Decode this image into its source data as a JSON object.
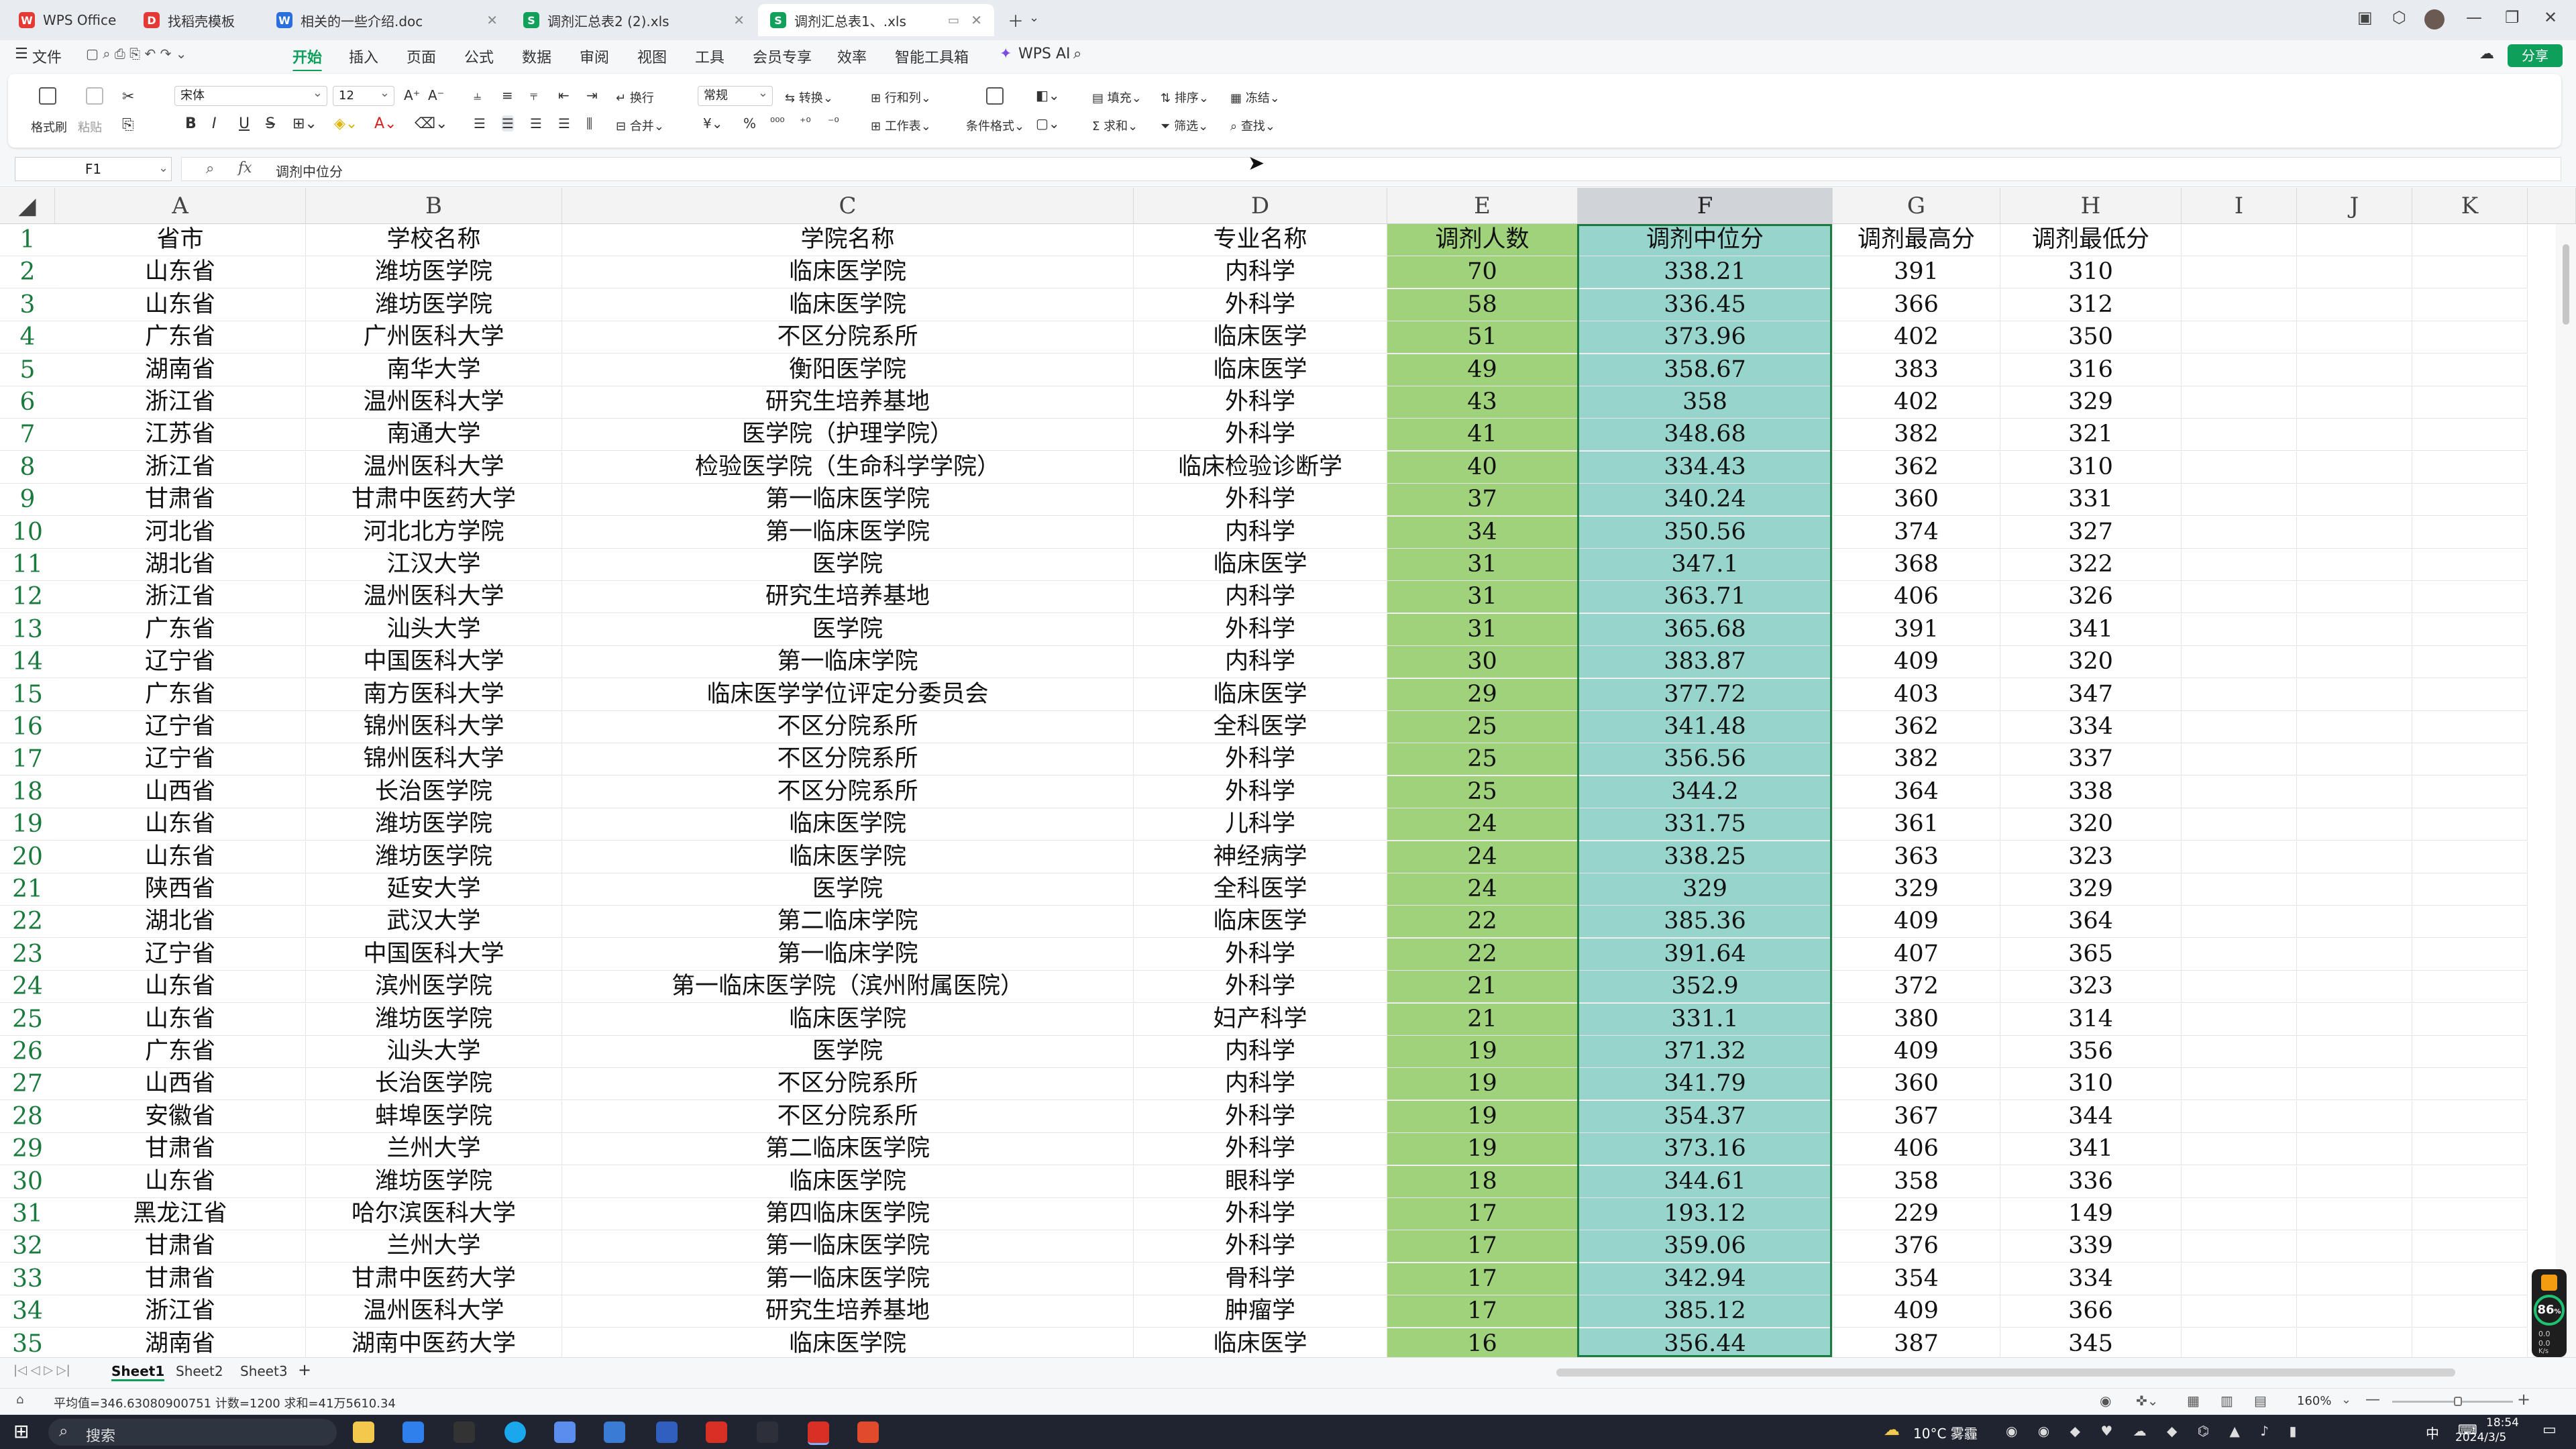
{
  "window_tabs": [
    {
      "label": "WPS Office",
      "icon": "wps-logo-icon",
      "color": "#e53935"
    },
    {
      "label": "找稻壳模板",
      "icon": "docer-icon",
      "color": "#e53935"
    },
    {
      "label": "相关的一些介绍.doc",
      "icon": "word-doc-icon",
      "color": "#2b6fde"
    },
    {
      "label": "调剂汇总表2 (2).xls",
      "icon": "sheet-icon",
      "color": "#13a05a"
    },
    {
      "label": "调剂汇总表1、.xls",
      "icon": "sheet-icon",
      "color": "#13a05a"
    }
  ],
  "menu": {
    "file": "文件",
    "items": [
      "开始",
      "插入",
      "页面",
      "公式",
      "数据",
      "审阅",
      "视图",
      "工具",
      "会员专享",
      "效率",
      "智能工具箱"
    ],
    "active": "开始",
    "wps_ai": "WPS AI",
    "share": "分享"
  },
  "ribbon": {
    "format_painter": "格式刷",
    "paste": "粘贴",
    "font_name": "宋体",
    "font_size": "12",
    "wrap": "换行",
    "merge": "合并",
    "number_format": "常规",
    "convert": "转换",
    "row_col": "行和列",
    "worksheet": "工作表",
    "conditional_format": "条件格式",
    "fill": "填充",
    "sort": "排序",
    "freeze": "冻结",
    "sum": "求和",
    "filter": "筛选",
    "find": "查找"
  },
  "formula_bar": {
    "name_box": "F1",
    "fx": "fx",
    "content": "调剂中位分"
  },
  "columns": [
    "A",
    "B",
    "C",
    "D",
    "E",
    "F",
    "G",
    "H",
    "I",
    "J",
    "K"
  ],
  "selected_column": "F",
  "colors": {
    "col_e_fill": "#9fd27a",
    "col_f_fill": "#97d4cb",
    "accent": "#0e9f5b",
    "row_number": "#1a7a3e"
  },
  "table": {
    "header": [
      "省市",
      "学校名称",
      "学院名称",
      "专业名称",
      "调剂人数",
      "调剂中位分",
      "调剂最高分",
      "调剂最低分"
    ],
    "rows": [
      [
        "山东省",
        "潍坊医学院",
        "临床医学院",
        "内科学",
        "70",
        "338.21",
        "391",
        "310"
      ],
      [
        "山东省",
        "潍坊医学院",
        "临床医学院",
        "外科学",
        "58",
        "336.45",
        "366",
        "312"
      ],
      [
        "广东省",
        "广州医科大学",
        "不区分院系所",
        "临床医学",
        "51",
        "373.96",
        "402",
        "350"
      ],
      [
        "湖南省",
        "南华大学",
        "衡阳医学院",
        "临床医学",
        "49",
        "358.67",
        "383",
        "316"
      ],
      [
        "浙江省",
        "温州医科大学",
        "研究生培养基地",
        "外科学",
        "43",
        "358",
        "402",
        "329"
      ],
      [
        "江苏省",
        "南通大学",
        "医学院（护理学院）",
        "外科学",
        "41",
        "348.68",
        "382",
        "321"
      ],
      [
        "浙江省",
        "温州医科大学",
        "检验医学院（生命科学学院）",
        "临床检验诊断学",
        "40",
        "334.43",
        "362",
        "310"
      ],
      [
        "甘肃省",
        "甘肃中医药大学",
        "第一临床医学院",
        "外科学",
        "37",
        "340.24",
        "360",
        "331"
      ],
      [
        "河北省",
        "河北北方学院",
        "第一临床医学院",
        "内科学",
        "34",
        "350.56",
        "374",
        "327"
      ],
      [
        "湖北省",
        "江汉大学",
        "医学院",
        "临床医学",
        "31",
        "347.1",
        "368",
        "322"
      ],
      [
        "浙江省",
        "温州医科大学",
        "研究生培养基地",
        "内科学",
        "31",
        "363.71",
        "406",
        "326"
      ],
      [
        "广东省",
        "汕头大学",
        "医学院",
        "外科学",
        "31",
        "365.68",
        "391",
        "341"
      ],
      [
        "辽宁省",
        "中国医科大学",
        "第一临床学院",
        "内科学",
        "30",
        "383.87",
        "409",
        "320"
      ],
      [
        "广东省",
        "南方医科大学",
        "临床医学学位评定分委员会",
        "临床医学",
        "29",
        "377.72",
        "403",
        "347"
      ],
      [
        "辽宁省",
        "锦州医科大学",
        "不区分院系所",
        "全科医学",
        "25",
        "341.48",
        "362",
        "334"
      ],
      [
        "辽宁省",
        "锦州医科大学",
        "不区分院系所",
        "外科学",
        "25",
        "356.56",
        "382",
        "337"
      ],
      [
        "山西省",
        "长治医学院",
        "不区分院系所",
        "外科学",
        "25",
        "344.2",
        "364",
        "338"
      ],
      [
        "山东省",
        "潍坊医学院",
        "临床医学院",
        "儿科学",
        "24",
        "331.75",
        "361",
        "320"
      ],
      [
        "山东省",
        "潍坊医学院",
        "临床医学院",
        "神经病学",
        "24",
        "338.25",
        "363",
        "323"
      ],
      [
        "陕西省",
        "延安大学",
        "医学院",
        "全科医学",
        "24",
        "329",
        "329",
        "329"
      ],
      [
        "湖北省",
        "武汉大学",
        "第二临床学院",
        "临床医学",
        "22",
        "385.36",
        "409",
        "364"
      ],
      [
        "辽宁省",
        "中国医科大学",
        "第一临床学院",
        "外科学",
        "22",
        "391.64",
        "407",
        "365"
      ],
      [
        "山东省",
        "滨州医学院",
        "第一临床医学院（滨州附属医院）",
        "外科学",
        "21",
        "352.9",
        "372",
        "323"
      ],
      [
        "山东省",
        "潍坊医学院",
        "临床医学院",
        "妇产科学",
        "21",
        "331.1",
        "380",
        "314"
      ],
      [
        "广东省",
        "汕头大学",
        "医学院",
        "内科学",
        "19",
        "371.32",
        "409",
        "356"
      ],
      [
        "山西省",
        "长治医学院",
        "不区分院系所",
        "内科学",
        "19",
        "341.79",
        "360",
        "310"
      ],
      [
        "安徽省",
        "蚌埠医学院",
        "不区分院系所",
        "外科学",
        "19",
        "354.37",
        "367",
        "344"
      ],
      [
        "甘肃省",
        "兰州大学",
        "第二临床医学院",
        "外科学",
        "19",
        "373.16",
        "406",
        "341"
      ],
      [
        "山东省",
        "潍坊医学院",
        "临床医学院",
        "眼科学",
        "18",
        "344.61",
        "358",
        "336"
      ],
      [
        "黑龙江省",
        "哈尔滨医科大学",
        "第四临床医学院",
        "外科学",
        "17",
        "193.12",
        "229",
        "149"
      ],
      [
        "甘肃省",
        "兰州大学",
        "第一临床医学院",
        "外科学",
        "17",
        "359.06",
        "376",
        "339"
      ],
      [
        "甘肃省",
        "甘肃中医药大学",
        "第一临床医学院",
        "骨科学",
        "17",
        "342.94",
        "354",
        "334"
      ],
      [
        "浙江省",
        "温州医科大学",
        "研究生培养基地",
        "肿瘤学",
        "17",
        "385.12",
        "409",
        "366"
      ],
      [
        "湖南省",
        "湖南中医药大学",
        "临床医学院",
        "临床医学",
        "16",
        "356.44",
        "387",
        "345"
      ]
    ]
  },
  "sheets": [
    "Sheet1",
    "Sheet2",
    "Sheet3"
  ],
  "active_sheet": "Sheet1",
  "status": {
    "summary": "平均值=346.63080900751 计数=1200 求和=41万5610.34",
    "zoom": "160%"
  },
  "side_widget": {
    "percent": "86",
    "pct_sign": "%",
    "up": "0.0",
    "down": "0.0",
    "unit": "K/s"
  },
  "taskbar": {
    "search": "搜索",
    "weather": "10°C 雾霾",
    "ime": "中",
    "time": "18:54",
    "date": "2024/3/5"
  }
}
